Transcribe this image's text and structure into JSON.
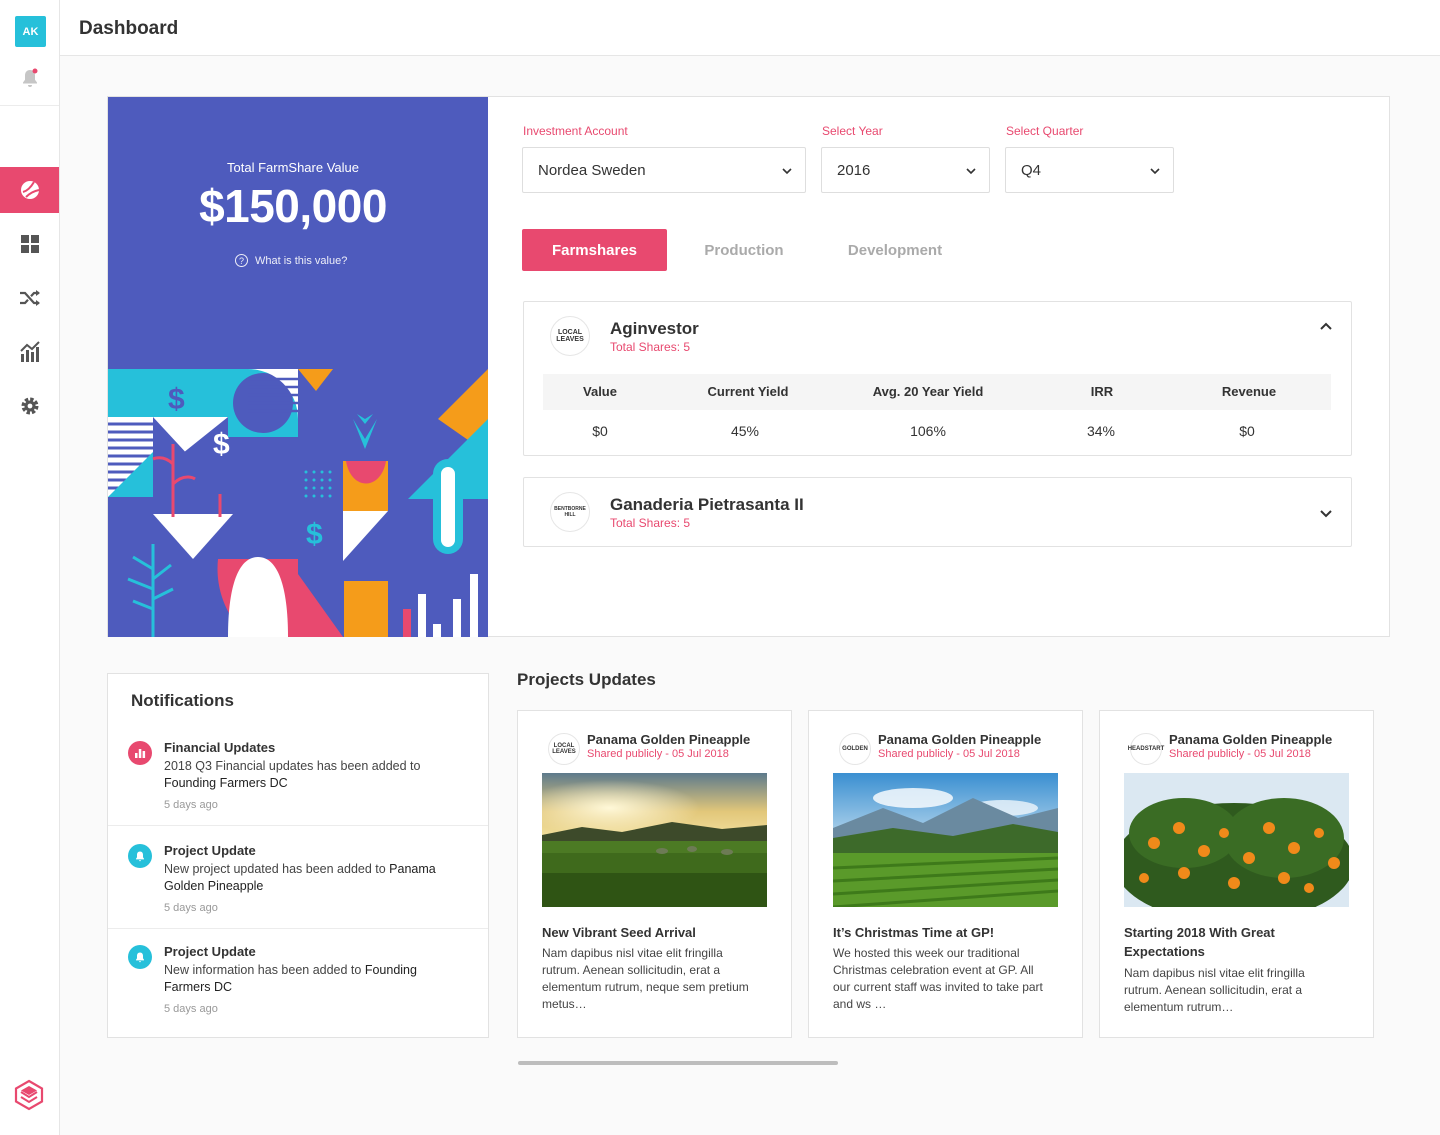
{
  "app": {
    "user_initials": "AK",
    "page_title": "Dashboard"
  },
  "sidebar": {
    "items": [
      {
        "name": "farmshares-icon",
        "active": true
      },
      {
        "name": "dashboard-grid-icon",
        "active": false
      },
      {
        "name": "shuffle-icon",
        "active": false
      },
      {
        "name": "analytics-icon",
        "active": false
      },
      {
        "name": "settings-gear-icon",
        "active": false
      }
    ]
  },
  "value_panel": {
    "label": "Total FarmShare Value",
    "amount": "$150,000",
    "help_text": "What is this value?",
    "help_icon": "?"
  },
  "filters": {
    "account": {
      "label": "Investment Account",
      "value": "Nordea Sweden"
    },
    "year": {
      "label": "Select Year",
      "value": "2016"
    },
    "quarter": {
      "label": "Select Quarter",
      "value": "Q4"
    }
  },
  "tabs": [
    {
      "label": "Farmshares",
      "active": true
    },
    {
      "label": "Production",
      "active": false
    },
    {
      "label": "Development",
      "active": false
    }
  ],
  "farms": [
    {
      "logo_text": "LOCAL LEAVES",
      "name": "Aginvestor",
      "shares": "Total Shares: 5",
      "expanded": true,
      "metrics_headers": [
        "Value",
        "Current Yield",
        "Avg. 20 Year Yield",
        "IRR",
        "Revenue"
      ],
      "metrics_values": [
        "$0",
        "45%",
        "106%",
        "34%",
        "$0"
      ]
    },
    {
      "logo_text": "BENTBORNE HILL",
      "name": "Ganaderia Pietrasanta II",
      "shares": "Total Shares: 5",
      "expanded": false
    }
  ],
  "notifications": {
    "title": "Notifications",
    "items": [
      {
        "icon": "bar-chart-icon",
        "color": "#e8496f",
        "title": "Financial Updates",
        "body_prefix": "2018 Q3 Financial updates has been added to ",
        "body_strong": "Founding Farmers DC",
        "time": "5 days ago"
      },
      {
        "icon": "bell-icon",
        "color": "#26c0da",
        "title": "Project Update",
        "body_prefix": "New project updated has been added to ",
        "body_strong": "Panama Golden Pineapple",
        "time": "5 days ago"
      },
      {
        "icon": "bell-icon",
        "color": "#26c0da",
        "title": "Project Update",
        "body_prefix": "New information has been added to ",
        "body_strong": "Founding Farmers DC",
        "time": "5 days ago"
      }
    ]
  },
  "projects": {
    "title": "Projects Updates",
    "items": [
      {
        "logo_text": "LOCAL LEAVES",
        "name": "Panama Golden Pineapple",
        "meta": "Shared publicly - 05 Jul 2018",
        "headline": "New Vibrant Seed Arrival",
        "body": "Nam dapibus nisl vitae elit fringilla rutrum. Aenean sollicitudin, erat a elementum rutrum, neque sem pretium metus…"
      },
      {
        "logo_text": "GOLDEN",
        "name": "Panama Golden Pineapple",
        "meta": "Shared publicly - 05 Jul 2018",
        "headline": "It’s Christmas Time at GP!",
        "body": "We hosted this week our traditional Christmas celebration event at GP. All our current staff was invited to take part and ws …"
      },
      {
        "logo_text": "HEADSTART",
        "name": "Panama Golden Pineapple",
        "meta": "Shared publicly - 05 Jul 2018",
        "headline": "Starting 2018 With Great Expectations",
        "body": "Nam dapibus nisl vitae elit fringilla rutrum. Aenean sollicitudin, erat a elementum rutrum…"
      }
    ]
  },
  "colors": {
    "accent": "#e8496f",
    "panel": "#4e5bbd",
    "teal": "#26c0da"
  }
}
